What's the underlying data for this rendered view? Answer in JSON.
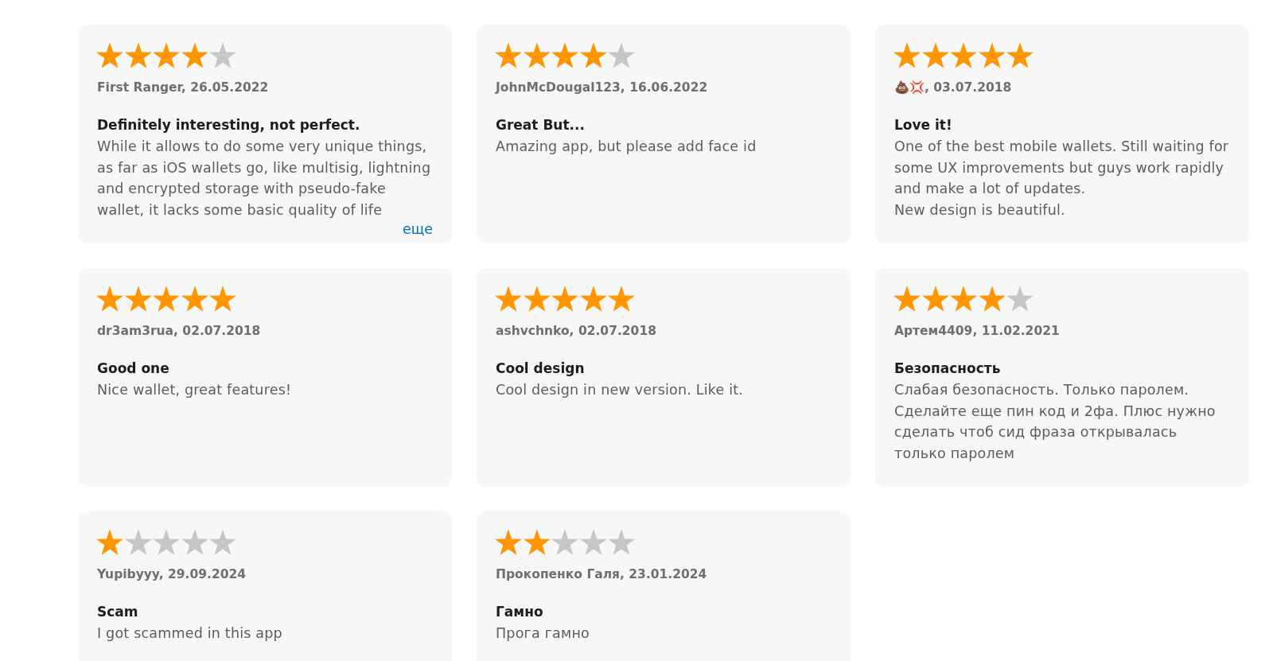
{
  "reviews": [
    {
      "stars": 4,
      "byline": "First Ranger, 26.05.2022",
      "title": "Definitely interesting, not perfect.",
      "body": "While it allows to do some very unique things, as far as iOS wallets go, like multisig, lightning and encrypted storage with pseudo-fake wallet, it lacks some basic quality of life",
      "more_link": "еще"
    },
    {
      "stars": 4,
      "byline": "JohnMcDougal123, 16.06.2022",
      "title": "Great But...",
      "body": "Amazing app, but please add face id"
    },
    {
      "stars": 5,
      "byline": "💩💢, 03.07.2018",
      "title": "Love it!",
      "body": "One of the best mobile wallets. Still waiting for some UX improvements but guys work rapidly and make a lot of updates.\nNew design is beautiful."
    },
    {
      "stars": 5,
      "byline": "dr3am3rua, 02.07.2018",
      "title": "Good one",
      "body": "Nice wallet, great features!"
    },
    {
      "stars": 5,
      "byline": "ashvchnko, 02.07.2018",
      "title": "Cool design",
      "body": "Cool design in new version. Like it."
    },
    {
      "stars": 4,
      "byline": "Артем4409, 11.02.2021",
      "title": "Безопасность",
      "body": "Слабая безопасность. Только паролем. Сделайте еще пин код и 2фа. Плюс нужно сделать чтоб сид фраза открывалась\nтолько паролем"
    },
    {
      "stars": 1,
      "byline": "Yupibyyy, 29.09.2024",
      "title": "Scam",
      "body": "I got scammed in this app"
    },
    {
      "stars": 2,
      "byline": "Прокопенко Галя, 23.01.2024",
      "title": "Гамно",
      "body": "Прога гамно"
    }
  ]
}
